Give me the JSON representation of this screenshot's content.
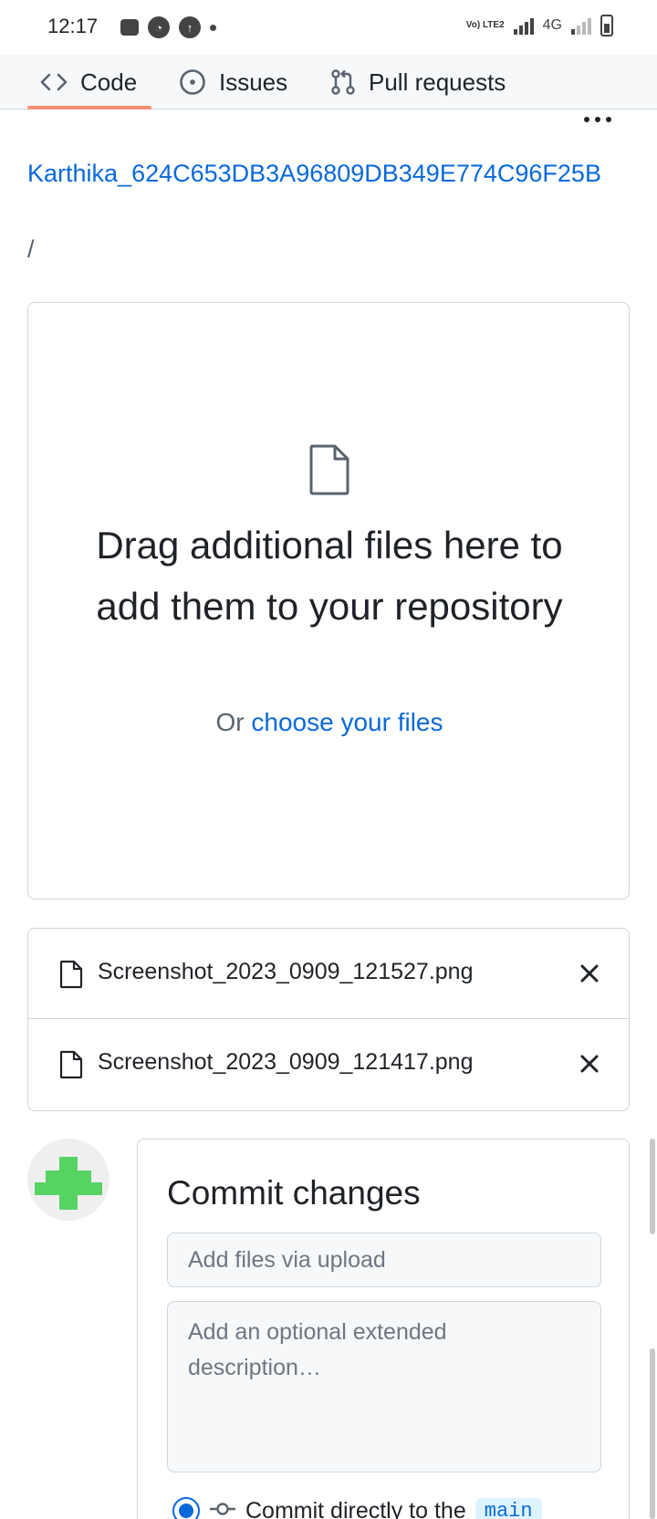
{
  "status_bar": {
    "time": "12:17",
    "network": "4G",
    "volte": "Vo) LTE2"
  },
  "repo_nav": {
    "tabs": [
      {
        "label": "Code",
        "icon": "code-icon",
        "selected": true
      },
      {
        "label": "Issues",
        "icon": "issue-icon",
        "selected": false
      },
      {
        "label": "Pull requests",
        "icon": "pull-request-icon",
        "selected": false
      }
    ],
    "more_icon": "kebab-horizontal-icon",
    "selected_underline_color": "#fd8c73"
  },
  "breadcrumb": {
    "repo": "Karthika_624C653DB3A96809DB349E774C96F25B",
    "separator": "/"
  },
  "dropzone": {
    "icon": "file-icon",
    "title": "Drag additional files here to add them to your repository",
    "sub_prefix": "Or",
    "sub_link": "choose your files"
  },
  "files": [
    {
      "name": "Screenshot_2023_0909_121527.png",
      "icon": "file-icon",
      "remove_icon": "x-icon"
    },
    {
      "name": "Screenshot_2023_0909_121417.png",
      "icon": "file-icon",
      "remove_icon": "x-icon"
    }
  ],
  "commit": {
    "title": "Commit changes",
    "summary_placeholder": "Add files via upload",
    "description_placeholder": "Add an optional extended description…",
    "option_label": "Commit directly to the",
    "branch": "main"
  },
  "colors": {
    "link": "#0969da",
    "avatar_green": "#57d364"
  }
}
